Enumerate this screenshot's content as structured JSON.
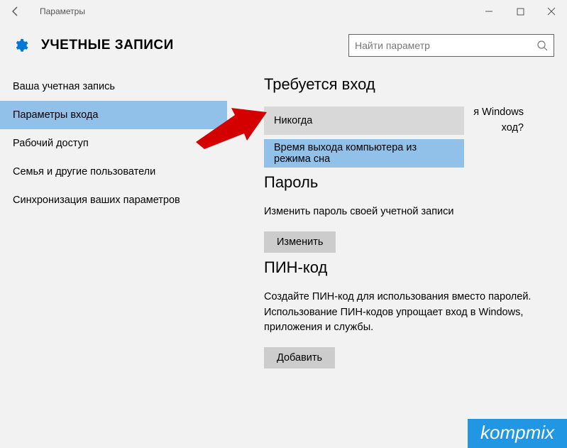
{
  "window": {
    "title": "Параметры"
  },
  "header": {
    "title": "УЧЕТНЫЕ ЗАПИСИ"
  },
  "search": {
    "placeholder": "Найти параметр"
  },
  "sidebar": {
    "items": [
      {
        "label": "Ваша учетная запись"
      },
      {
        "label": "Параметры входа"
      },
      {
        "label": "Рабочий доступ"
      },
      {
        "label": "Семья и другие пользователи"
      },
      {
        "label": "Синхронизация ваших параметров"
      }
    ]
  },
  "main": {
    "require_signin": {
      "heading": "Требуется вход",
      "behind_text_1": "я Windows",
      "behind_text_2": "ход?",
      "option_never": "Никогда",
      "option_sleep": "Время выхода компьютера из режима сна"
    },
    "password": {
      "heading": "Пароль",
      "desc": "Изменить пароль своей учетной записи",
      "button": "Изменить"
    },
    "pin": {
      "heading": "ПИН-код",
      "desc": "Создайте ПИН-код для использования вместо паролей. Использование ПИН-кодов упрощает вход в Windows, приложения и службы.",
      "button": "Добавить"
    }
  },
  "watermark": "kompmix"
}
